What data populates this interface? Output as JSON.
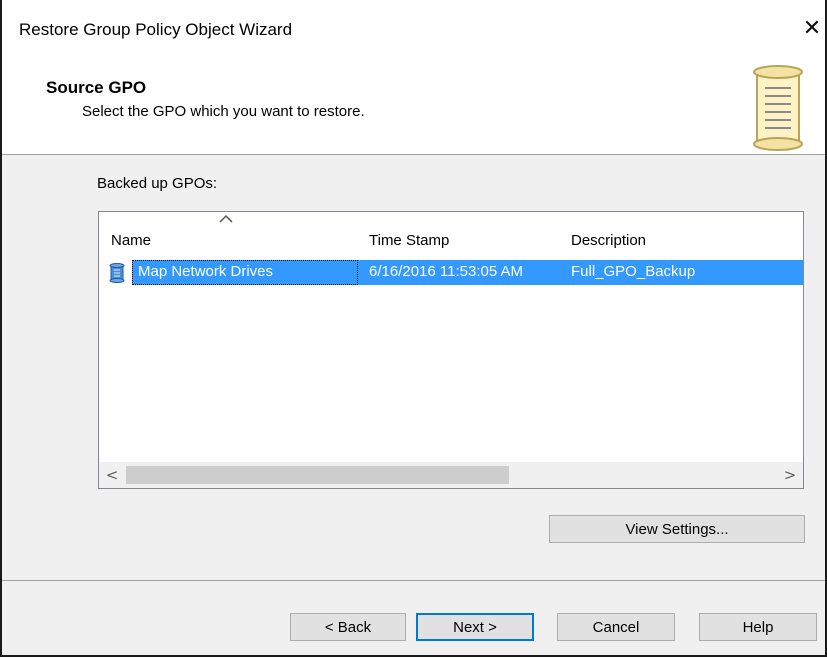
{
  "window": {
    "title": "Restore Group Policy Object Wizard",
    "close_glyph": "✕"
  },
  "header": {
    "title": "Source GPO",
    "subtitle": "Select the GPO which you want to restore.",
    "icon": "scroll-icon"
  },
  "list": {
    "label": "Backed up GPOs:",
    "sort_indicator": "^",
    "columns": [
      "Name",
      "Time Stamp",
      "Description"
    ],
    "rows": [
      {
        "icon": "gpo-icon",
        "name": "Map Network Drives",
        "timestamp": "6/16/2016 11:53:05 AM",
        "description": "Full_GPO_Backup",
        "selected": true
      }
    ],
    "scroll_left": "<",
    "scroll_right": ">"
  },
  "buttons": {
    "view_settings": "View Settings...",
    "back": "< Back",
    "next": "Next >",
    "cancel": "Cancel",
    "help": "Help"
  },
  "colors": {
    "selection": "#3399ff",
    "default_button_border": "#0078d7"
  }
}
